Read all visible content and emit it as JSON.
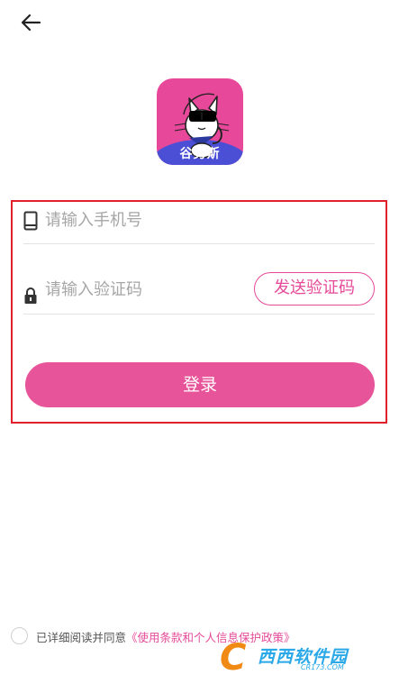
{
  "logo": {
    "text": "谷男斯"
  },
  "login_form": {
    "phone_placeholder": "请输入手机号",
    "code_placeholder": "请输入验证码",
    "send_code_label": "发送验证码",
    "login_label": "登录"
  },
  "agreement": {
    "prefix": "已详细阅读并同意",
    "link_text": "《使用条款和个人信息保护政策》"
  },
  "watermark": {
    "title": "西西软件园",
    "subtitle": "CR173.COM"
  },
  "colors": {
    "accent": "#e8549a",
    "highlight_border": "#e0202a",
    "logo_band": "#4a4fd6"
  },
  "icons": [
    "back-arrow-icon",
    "phone-icon",
    "lock-icon",
    "cat-logo-icon"
  ]
}
